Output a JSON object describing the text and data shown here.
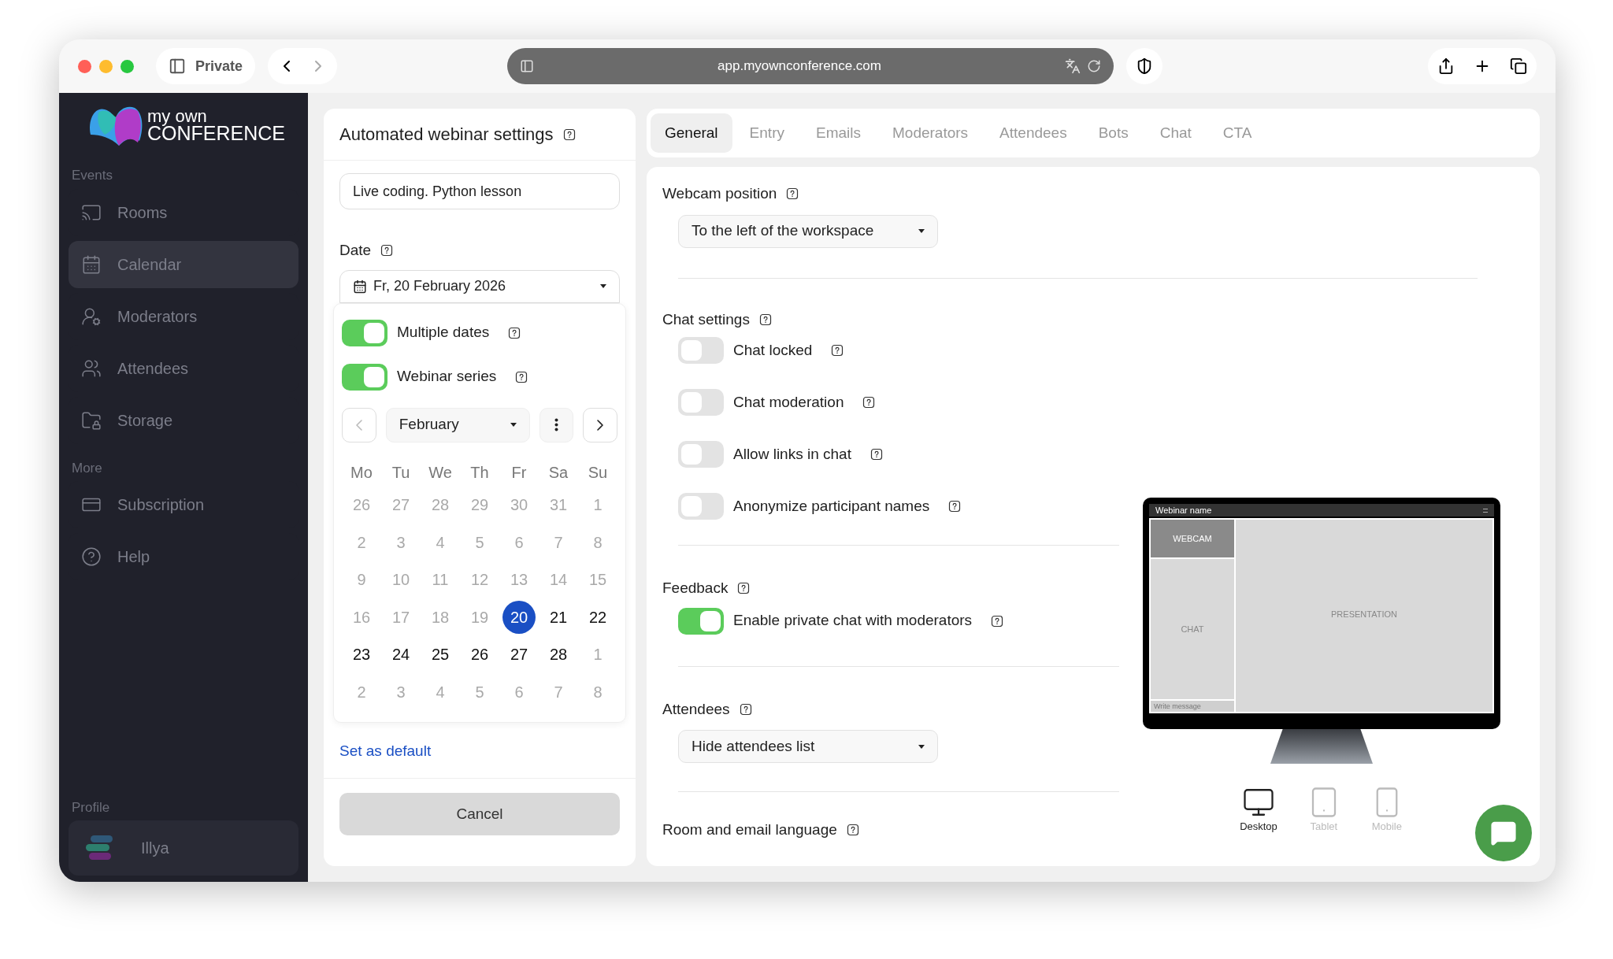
{
  "browser": {
    "profile": "Private",
    "url": "app.myownconference.com"
  },
  "logo": {
    "line1": "my own",
    "line2": "CONFERENCE"
  },
  "sidebar": {
    "sections": [
      {
        "title": "Events",
        "items": [
          {
            "label": "Rooms",
            "kind": "cast",
            "selected": false
          },
          {
            "label": "Calendar",
            "kind": "calendar",
            "selected": true
          },
          {
            "label": "Moderators",
            "kind": "moderator",
            "selected": false
          },
          {
            "label": "Attendees",
            "kind": "users",
            "selected": false
          },
          {
            "label": "Storage",
            "kind": "folder",
            "selected": false
          }
        ]
      },
      {
        "title": "More",
        "items": [
          {
            "label": "Subscription",
            "kind": "card",
            "selected": false
          },
          {
            "label": "Help",
            "kind": "help",
            "selected": false
          }
        ]
      }
    ],
    "profile": {
      "title": "Profile",
      "name": "Illya"
    }
  },
  "settings": {
    "title": "Automated webinar settings",
    "name_value": "Live coding. Python lesson",
    "date_label": "Date",
    "date_value": "Fr, 20 February 2026",
    "toggles": [
      {
        "label": "Multiple dates",
        "on": true
      },
      {
        "label": "Webinar series",
        "on": true
      }
    ],
    "calendar": {
      "month": "February",
      "weekdays": [
        "Mo",
        "Tu",
        "We",
        "Th",
        "Fr",
        "Sa",
        "Su"
      ],
      "weeks": [
        [
          {
            "day": "26",
            "disabled": true,
            "selected": false
          },
          {
            "day": "27",
            "disabled": true,
            "selected": false
          },
          {
            "day": "28",
            "disabled": true,
            "selected": false
          },
          {
            "day": "29",
            "disabled": true,
            "selected": false
          },
          {
            "day": "30",
            "disabled": true,
            "selected": false
          },
          {
            "day": "31",
            "disabled": true,
            "selected": false
          },
          {
            "day": "1",
            "disabled": true,
            "selected": false
          }
        ],
        [
          {
            "day": "2",
            "disabled": true,
            "selected": false
          },
          {
            "day": "3",
            "disabled": true,
            "selected": false
          },
          {
            "day": "4",
            "disabled": true,
            "selected": false
          },
          {
            "day": "5",
            "disabled": true,
            "selected": false
          },
          {
            "day": "6",
            "disabled": true,
            "selected": false
          },
          {
            "day": "7",
            "disabled": true,
            "selected": false
          },
          {
            "day": "8",
            "disabled": true,
            "selected": false
          }
        ],
        [
          {
            "day": "9",
            "disabled": true,
            "selected": false
          },
          {
            "day": "10",
            "disabled": true,
            "selected": false
          },
          {
            "day": "11",
            "disabled": true,
            "selected": false
          },
          {
            "day": "12",
            "disabled": true,
            "selected": false
          },
          {
            "day": "13",
            "disabled": true,
            "selected": false
          },
          {
            "day": "14",
            "disabled": true,
            "selected": false
          },
          {
            "day": "15",
            "disabled": true,
            "selected": false
          }
        ],
        [
          {
            "day": "16",
            "disabled": true,
            "selected": false
          },
          {
            "day": "17",
            "disabled": true,
            "selected": false
          },
          {
            "day": "18",
            "disabled": true,
            "selected": false
          },
          {
            "day": "19",
            "disabled": true,
            "selected": false
          },
          {
            "day": "20",
            "disabled": false,
            "selected": true
          },
          {
            "day": "21",
            "disabled": false,
            "selected": false
          },
          {
            "day": "22",
            "disabled": false,
            "selected": false
          }
        ],
        [
          {
            "day": "23",
            "disabled": false,
            "selected": false
          },
          {
            "day": "24",
            "disabled": false,
            "selected": false
          },
          {
            "day": "25",
            "disabled": false,
            "selected": false
          },
          {
            "day": "26",
            "disabled": false,
            "selected": false
          },
          {
            "day": "27",
            "disabled": false,
            "selected": false
          },
          {
            "day": "28",
            "disabled": false,
            "selected": false
          },
          {
            "day": "1",
            "disabled": true,
            "selected": false
          }
        ],
        [
          {
            "day": "2",
            "disabled": true,
            "selected": false
          },
          {
            "day": "3",
            "disabled": true,
            "selected": false
          },
          {
            "day": "4",
            "disabled": true,
            "selected": false
          },
          {
            "day": "5",
            "disabled": true,
            "selected": false
          },
          {
            "day": "6",
            "disabled": true,
            "selected": false
          },
          {
            "day": "7",
            "disabled": true,
            "selected": false
          },
          {
            "day": "8",
            "disabled": true,
            "selected": false
          }
        ]
      ]
    },
    "default_link": "Set as default",
    "cancel": "Cancel"
  },
  "tabs": [
    {
      "label": "General",
      "selected": true
    },
    {
      "label": "Entry",
      "selected": false
    },
    {
      "label": "Emails",
      "selected": false
    },
    {
      "label": "Moderators",
      "selected": false
    },
    {
      "label": "Attendees",
      "selected": false
    },
    {
      "label": "Bots",
      "selected": false
    },
    {
      "label": "Chat",
      "selected": false
    },
    {
      "label": "CTA",
      "selected": false
    }
  ],
  "general": {
    "webcam": {
      "label": "Webcam position",
      "value": "To the left of the workspace"
    },
    "chat": {
      "label": "Chat settings",
      "toggles": [
        {
          "label": "Chat locked",
          "on": false
        },
        {
          "label": "Chat moderation",
          "on": false
        },
        {
          "label": "Allow links in chat",
          "on": false
        },
        {
          "label": "Anonymize participant names",
          "on": false
        }
      ]
    },
    "feedback": {
      "label": "Feedback",
      "toggles": [
        {
          "label": "Enable private chat with moderators",
          "on": true
        }
      ]
    },
    "attendees": {
      "label": "Attendees",
      "value": "Hide attendees list"
    },
    "language": {
      "label": "Room and email language"
    }
  },
  "preview": {
    "title": "Webinar name",
    "webcam": "WEBCAM",
    "chat": "CHAT",
    "message": "Write message",
    "presentation": "PRESENTATION",
    "devices": [
      {
        "label": "Desktop",
        "kind": "desktop",
        "selected": true
      },
      {
        "label": "Tablet",
        "kind": "tablet",
        "selected": false
      },
      {
        "label": "Mobile",
        "kind": "mobile",
        "selected": false
      }
    ]
  }
}
